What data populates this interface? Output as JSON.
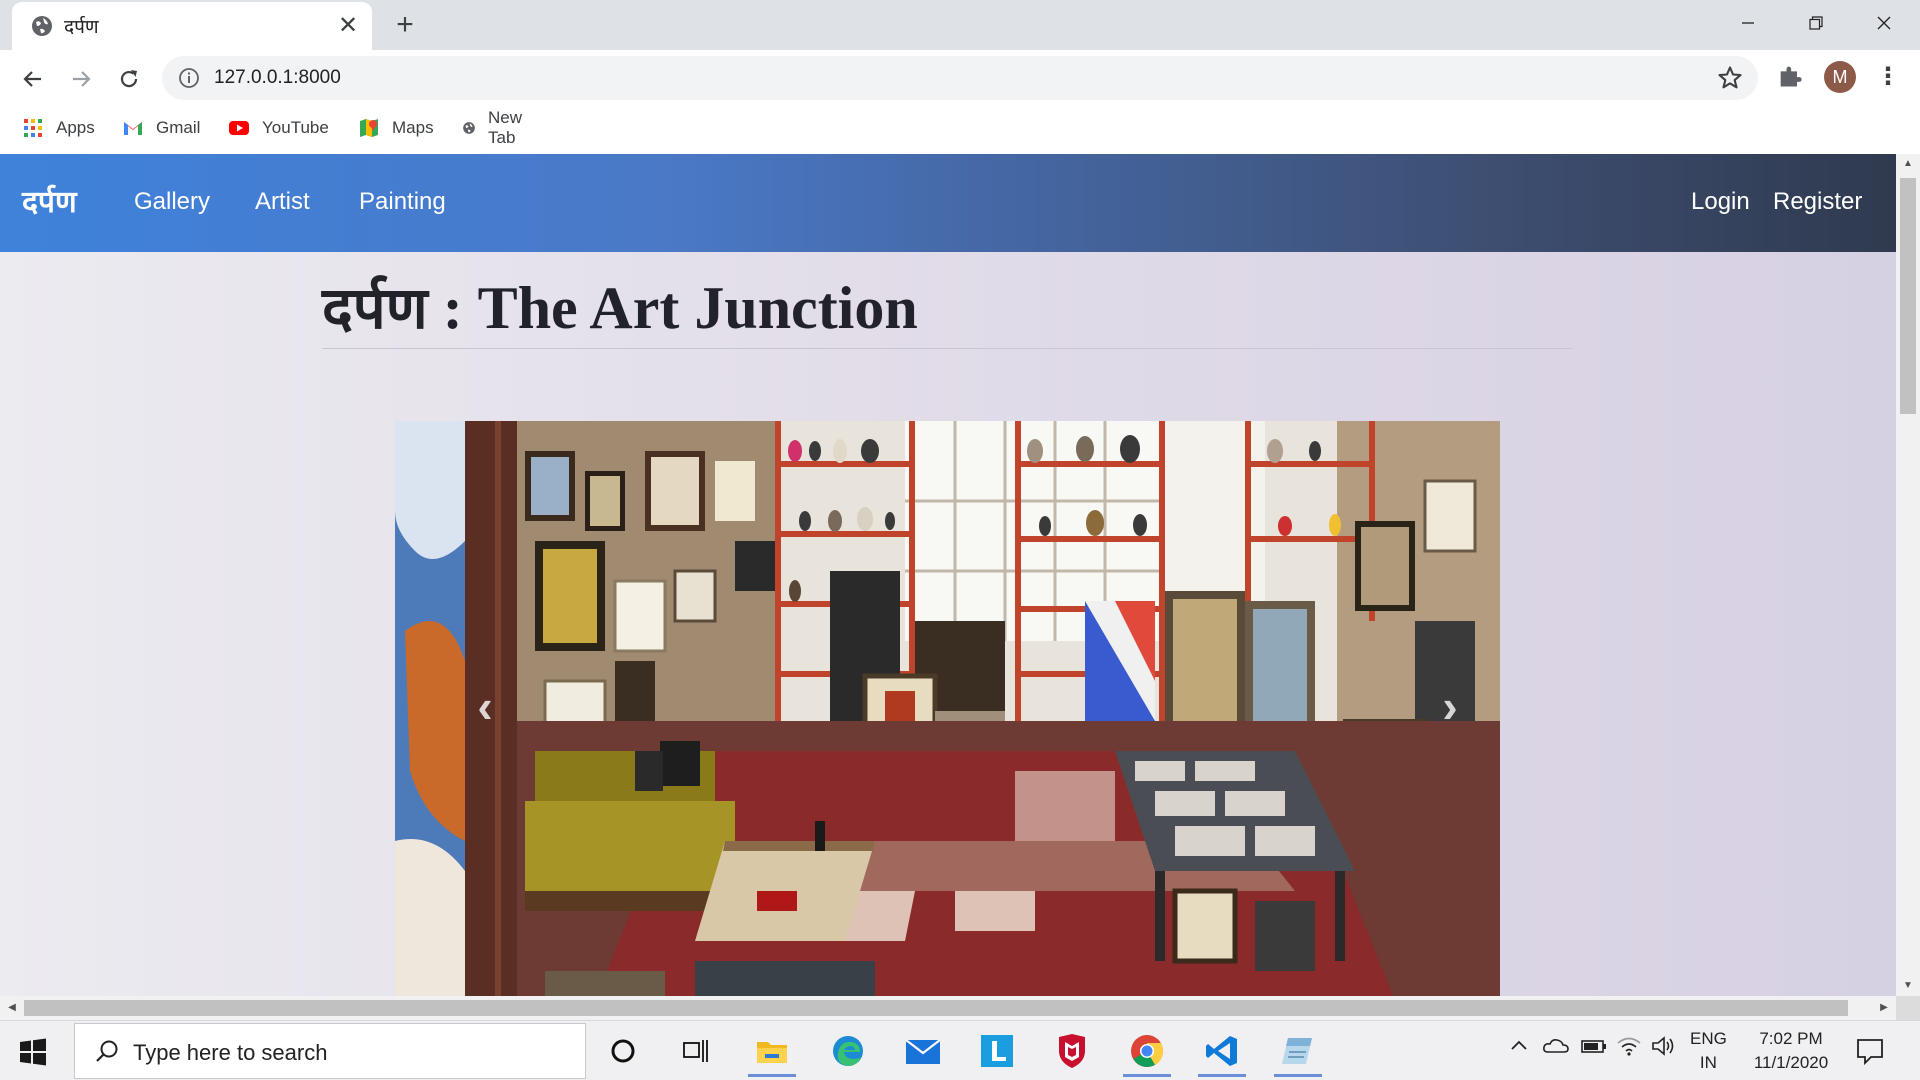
{
  "browser": {
    "tab_title": "दर्पण",
    "new_tab_symbol": "+",
    "close_symbol": "✕",
    "url": "127.0.0.1:8000",
    "profile_initial": "M",
    "bookmarks": [
      {
        "label": "Apps",
        "icon": "apps-grid-icon"
      },
      {
        "label": "Gmail",
        "icon": "gmail-icon"
      },
      {
        "label": "YouTube",
        "icon": "youtube-icon"
      },
      {
        "label": "Maps",
        "icon": "maps-icon"
      },
      {
        "label": "New Tab",
        "icon": "globe-icon"
      }
    ]
  },
  "site": {
    "brand": "दर्पण",
    "nav": {
      "gallery": "Gallery",
      "artist": "Artist",
      "painting": "Painting",
      "login": "Login",
      "register": "Register"
    },
    "heading_dev": "दर्पण",
    "heading_rest": " : The Art Junction",
    "carousel": {
      "prev_symbol": "‹",
      "next_symbol": "›"
    }
  },
  "taskbar": {
    "search_placeholder": "Type here to search",
    "language_top": "ENG",
    "language_bottom": "IN",
    "time": "7:02 PM",
    "date": "11/1/2020"
  },
  "colors": {
    "navbar_start": "#3e82db",
    "navbar_end": "#2f3a4f",
    "page_bg": "#e2dde9"
  }
}
